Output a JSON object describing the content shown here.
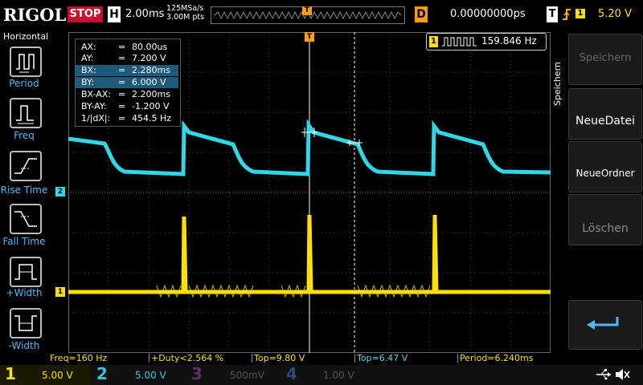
{
  "top": {
    "brand": "RIGOL",
    "run_state": "STOP",
    "timebase_letter": "H",
    "timebase": "2.00ms",
    "sample_rate": "125MSa/s",
    "memory_depth": "3.00M pts",
    "trigger_pos_marker": "T",
    "delay_letter": "D",
    "delay": "0.00000000ps",
    "trigger_letter": "T",
    "trigger_channel": "1",
    "trigger_level": "5.20 V"
  },
  "left_panel": {
    "title": "Horizontal",
    "buttons": [
      {
        "label": "Period",
        "icon": "period-icon"
      },
      {
        "label": "Freq",
        "icon": "frequency-icon"
      },
      {
        "label": "Rise Time",
        "icon": "rise-time-icon"
      },
      {
        "label": "Fall Time",
        "icon": "fall-time-icon"
      },
      {
        "label": "+Width",
        "icon": "positive-width-icon"
      },
      {
        "label": "-Width",
        "icon": "negative-width-icon"
      }
    ]
  },
  "cursors": {
    "rows": [
      {
        "key": "AX:",
        "eq": "=",
        "value": "80.00us",
        "highlight": false
      },
      {
        "key": "AY:",
        "eq": "=",
        "value": "7.200 V",
        "highlight": false
      },
      {
        "key": "BX:",
        "eq": "=",
        "value": "2.280ms",
        "highlight": true
      },
      {
        "key": "BY:",
        "eq": "=",
        "value": "6.000 V",
        "highlight": true
      },
      {
        "key": "BX-AX:",
        "eq": "=",
        "value": "2.200ms",
        "highlight": false
      },
      {
        "key": "BY-AY:",
        "eq": "=",
        "value": "-1.200 V",
        "highlight": false
      },
      {
        "key": "1/|dX|:",
        "eq": "=",
        "value": "454.5 Hz",
        "highlight": false
      }
    ]
  },
  "frequency_counter": {
    "channel": "1",
    "value": "159.846 Hz"
  },
  "channel_markers": {
    "ch1": "1",
    "ch2": "2"
  },
  "right_menu": {
    "title": "Speichern",
    "items": [
      {
        "label": "Speichern",
        "enabled": false
      },
      {
        "label": "NeueDatei",
        "enabled": true
      },
      {
        "label": "NeueOrdner",
        "enabled": true
      },
      {
        "label": "Löschen",
        "enabled": false
      },
      {
        "label": "",
        "enabled": true,
        "icon": "return-arrow-icon"
      }
    ]
  },
  "status_bar": [
    {
      "text": "Freq=160 Hz",
      "color": "yellow"
    },
    {
      "text": "+Duty<2.564 %",
      "color": "yellow"
    },
    {
      "text": "Top=9.80 V",
      "color": "yellow"
    },
    {
      "text": "Top=6.47 V",
      "color": "cyan"
    },
    {
      "text": "Period=6.240ms",
      "color": "yellow"
    }
  ],
  "channels": [
    {
      "num": "1",
      "scale": "5.00 V",
      "color": "#ffe000",
      "active": true
    },
    {
      "num": "2",
      "scale": "5.00 V",
      "color": "#2fc8dc",
      "active": true
    },
    {
      "num": "3",
      "scale": "500mV",
      "color": "#c060c0",
      "active": false
    },
    {
      "num": "4",
      "scale": "1.00 V",
      "color": "#3a6fd0",
      "active": false
    }
  ],
  "colors": {
    "ch1": "#ffe000",
    "ch2": "#2fd8e8",
    "accent_orange": "#ff9a1a",
    "stop_red": "#c8102e",
    "menu_blue": "#4db8ff"
  }
}
